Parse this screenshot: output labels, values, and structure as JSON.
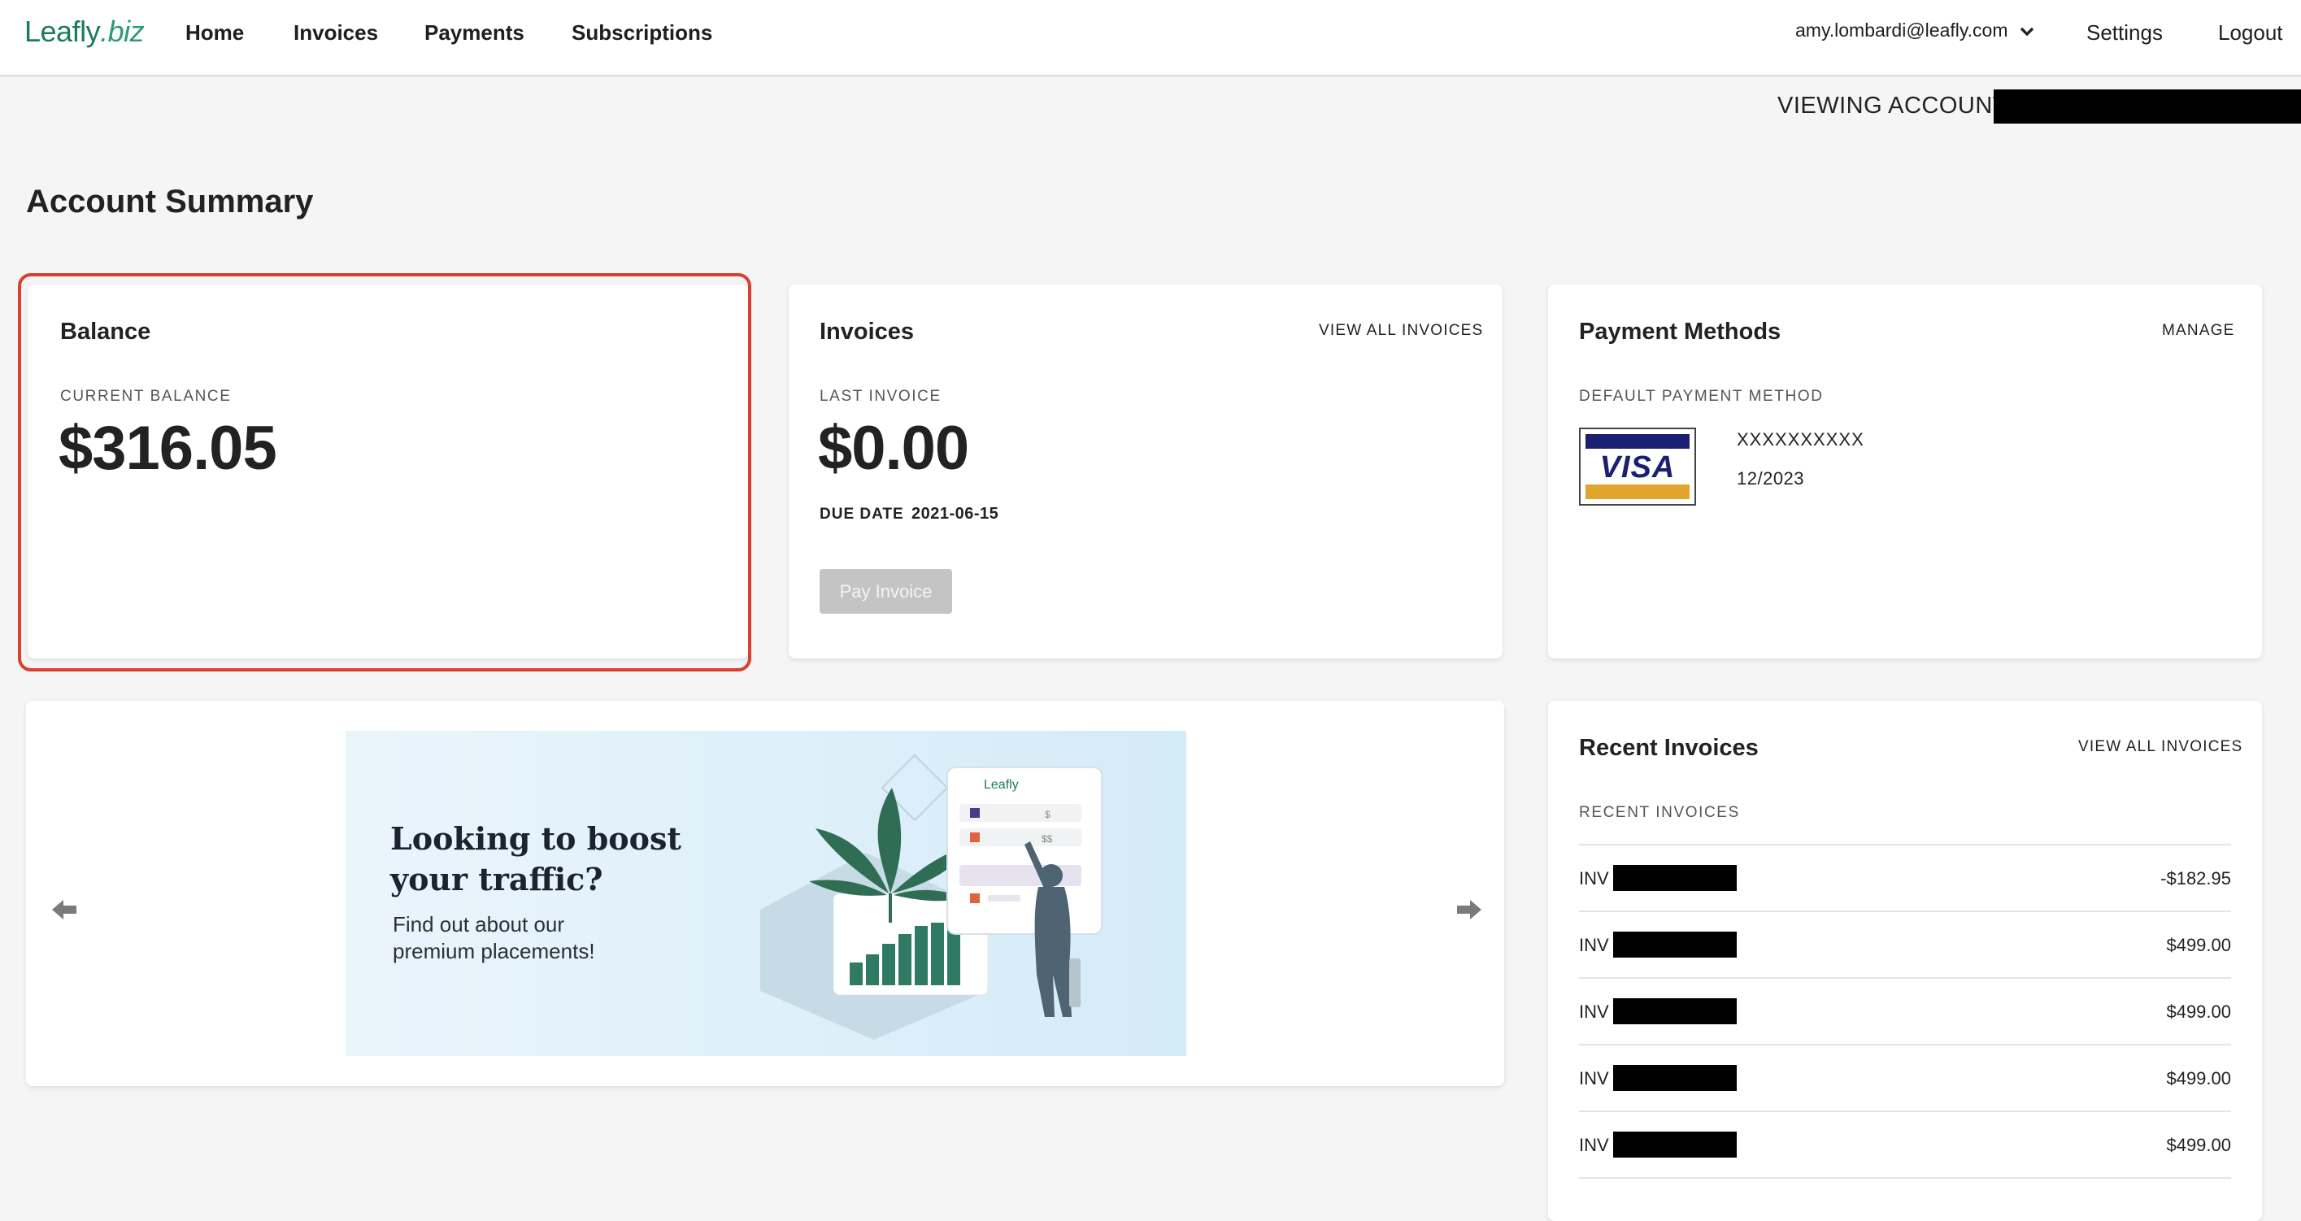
{
  "nav": {
    "logo_main": "Leafly",
    "logo_suffix": ".biz",
    "links": [
      "Home",
      "Invoices",
      "Payments",
      "Subscriptions"
    ],
    "user_email": "amy.lombardi@leafly.com",
    "settings": "Settings",
    "logout": "Logout"
  },
  "viewing_account_label": "VIEWING ACCOUNT:",
  "page_title": "Account Summary",
  "balance": {
    "title": "Balance",
    "label": "CURRENT BALANCE",
    "amount": "$316.05"
  },
  "invoices": {
    "title": "Invoices",
    "action": "VIEW ALL INVOICES",
    "label": "LAST INVOICE",
    "amount": "$0.00",
    "due_label": "DUE DATE",
    "due_date": "2021-06-15",
    "pay_button": "Pay Invoice"
  },
  "payment_methods": {
    "title": "Payment Methods",
    "action": "MANAGE",
    "label": "DEFAULT PAYMENT METHOD",
    "card_brand": "VISA",
    "card_number": "XXXXXXXXXX",
    "card_expiry": "12/2023"
  },
  "promo": {
    "headline_line1": "Looking to boost",
    "headline_line2": "your traffic?",
    "sub_line1": "Find out about our",
    "sub_line2": "premium placements!",
    "mockup_logo": "Leafly",
    "mockup_price1": "$",
    "mockup_price2": "$$",
    "prev_icon": "arrow-left-icon",
    "next_icon": "arrow-right-icon"
  },
  "recent_invoices": {
    "title": "Recent Invoices",
    "action": "VIEW ALL INVOICES",
    "label": "RECENT INVOICES",
    "rows": [
      {
        "prefix": "INV",
        "amount": "-$182.95"
      },
      {
        "prefix": "INV",
        "amount": "$499.00"
      },
      {
        "prefix": "INV",
        "amount": "$499.00"
      },
      {
        "prefix": "INV",
        "amount": "$499.00"
      },
      {
        "prefix": "INV",
        "amount": "$499.00"
      }
    ]
  },
  "colors": {
    "brand_green": "#1c7a5e",
    "highlight_red": "#d9402e",
    "visa_blue": "#1a1f71",
    "visa_gold": "#e1a52b"
  }
}
